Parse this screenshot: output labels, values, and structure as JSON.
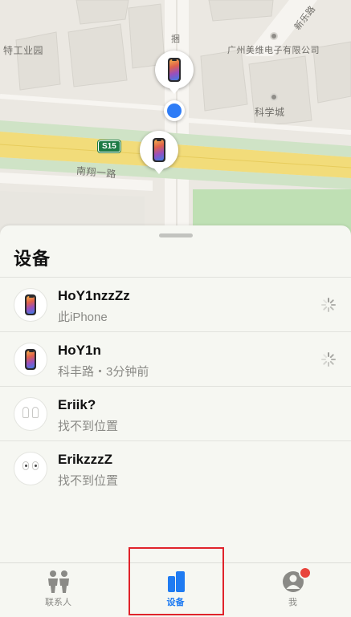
{
  "map": {
    "labels": {
      "area_west": "特工业园",
      "company": "广州美维电子有限公司",
      "science_city": "科学城",
      "road_south": "南翔一路",
      "road_ne": "新乐路",
      "road_vertical": "捆"
    },
    "highway_shield": "S15",
    "colors": {
      "land": "#ebe8e2",
      "block": "#dedbd4",
      "highway": "#f2dc7a",
      "green": "#cfe3c6",
      "location_dot": "#2e7cf6"
    }
  },
  "sheet": {
    "title": "设备",
    "devices": [
      {
        "name": "HoY1nzzZz",
        "subtitle": "此iPhone",
        "icon": "iphone-icon",
        "loading": true
      },
      {
        "name": "HoY1n",
        "subtitle": "科丰路・3分钟前",
        "icon": "iphone-icon",
        "loading": true
      },
      {
        "name": "Eriik?",
        "subtitle": "找不到位置",
        "icon": "airpods-icon",
        "loading": false
      },
      {
        "name": "ErikzzzZ",
        "subtitle": "找不到位置",
        "icon": "airpods-pro-icon",
        "loading": false
      }
    ]
  },
  "tabbar": {
    "tabs": [
      {
        "label": "联系人",
        "icon": "people-icon",
        "active": false
      },
      {
        "label": "设备",
        "icon": "devices-icon",
        "active": true
      },
      {
        "label": "我",
        "icon": "person-icon",
        "active": false
      }
    ],
    "accent": "#1f7bf2",
    "highlight_color": "#e0232b"
  }
}
